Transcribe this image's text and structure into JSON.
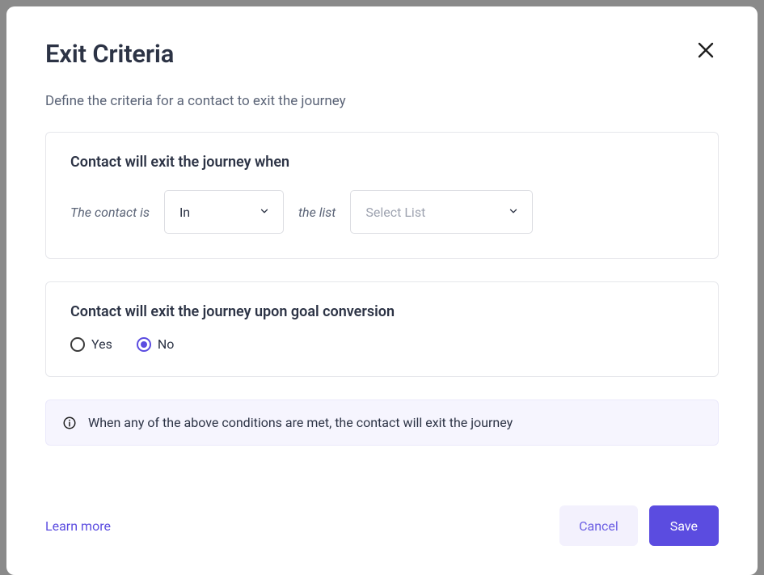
{
  "modal": {
    "title": "Exit Criteria",
    "subtitle": "Define the criteria for a contact to exit the journey"
  },
  "panel1": {
    "title": "Contact will exit the journey when",
    "label_prefix": "The contact is",
    "condition_value": "In",
    "label_mid": "the list",
    "list_placeholder": "Select List"
  },
  "panel2": {
    "title": "Contact will exit the journey upon goal conversion",
    "option_yes": "Yes",
    "option_no": "No",
    "selected": "No"
  },
  "info_banner": {
    "text": "When any of the above conditions are met, the contact will exit the journey"
  },
  "footer": {
    "learn_more": "Learn more",
    "cancel": "Cancel",
    "save": "Save"
  }
}
